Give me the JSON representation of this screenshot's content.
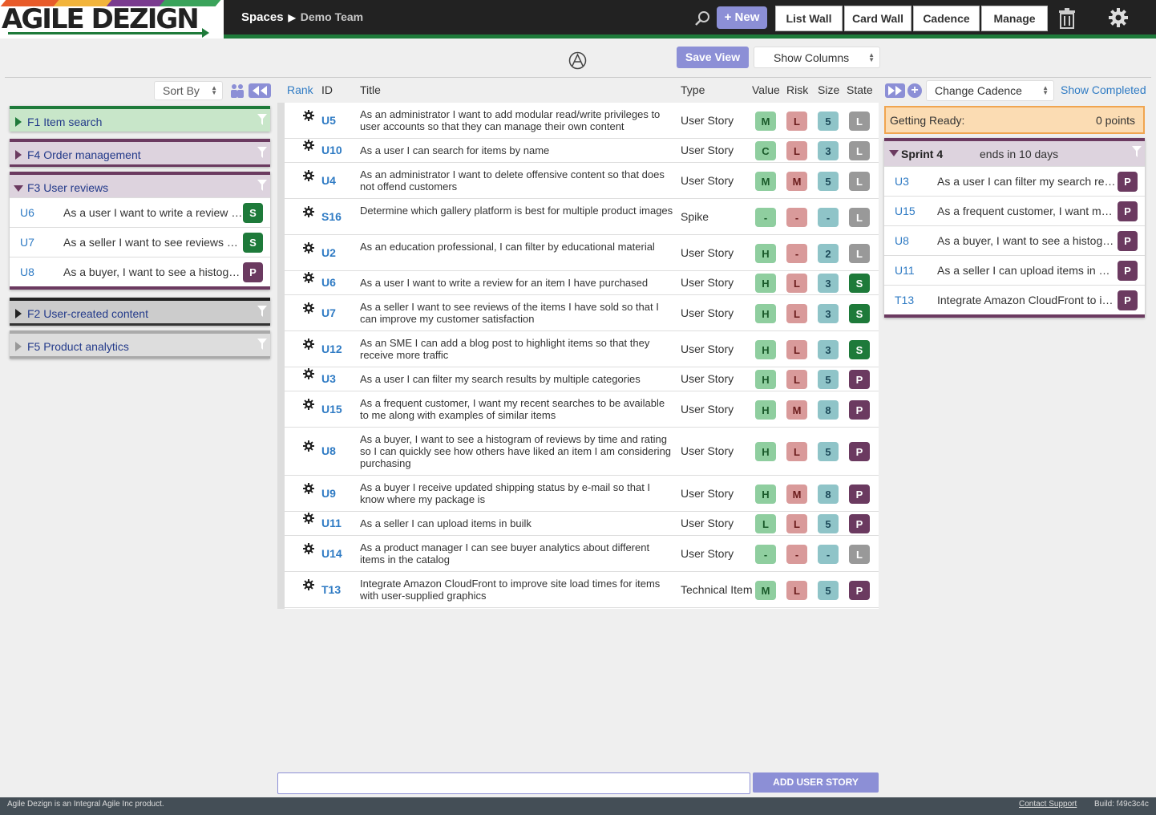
{
  "header": {
    "logo_text": "AGILE DEZIGN",
    "breadcrumb_spaces": "Spaces",
    "breadcrumb_team": "Demo Team",
    "new_label": "New",
    "nav": [
      "List Wall",
      "Card Wall",
      "Cadence",
      "Manage"
    ],
    "search_icon": "search-icon",
    "trash_icon": "trash-icon",
    "settings_icon": "gear-icon"
  },
  "toolbar": {
    "save_view_label": "Save View",
    "show_columns_label": "Show Columns"
  },
  "left_panel": {
    "sort_by_label": "Sort By",
    "features": [
      {
        "label": "F1 Item search",
        "expanded": false,
        "color": "#1e7a3a",
        "bg": "#c8e6c9",
        "items": []
      },
      {
        "label": "F4 Order management",
        "expanded": false,
        "color": "#6b3a60",
        "bg": "#ddd3de",
        "items": []
      },
      {
        "label": "F3 User reviews",
        "expanded": true,
        "color": "#6b3a60",
        "bg": "#ddd3de",
        "items": [
          {
            "id": "U6",
            "title": "As a user I want to write a review for an item I have purchased",
            "state": "S"
          },
          {
            "id": "U7",
            "title": "As a seller I want to see reviews of the items I have sold so that I can improve my customer satisfaction",
            "state": "S"
          },
          {
            "id": "U8",
            "title": "As a buyer, I want to see a histogram of reviews by time and rating",
            "state": "P"
          }
        ]
      },
      {
        "label": "F2 User-created content",
        "expanded": false,
        "color": "#222222",
        "bg": "#cccccc",
        "items": []
      },
      {
        "label": "F5 Product analytics",
        "expanded": false,
        "color": "#999999",
        "bg": "#dddddd",
        "items": []
      }
    ]
  },
  "table": {
    "headers": {
      "rank": "Rank",
      "id": "ID",
      "title": "Title",
      "type": "Type",
      "value": "Value",
      "risk": "Risk",
      "size": "Size",
      "state": "State"
    },
    "rows": [
      {
        "id": "U5",
        "title": "As an administrator I want to add modular read/write privileges to user accounts so that they can manage their own content",
        "type": "User Story",
        "value": "M",
        "risk": "L",
        "size": "5",
        "state": "L"
      },
      {
        "id": "U10",
        "title": "As a user I can search for items by name",
        "type": "User Story",
        "value": "C",
        "risk": "L",
        "size": "3",
        "state": "L"
      },
      {
        "id": "U4",
        "title": "As an administrator I want to delete offensive content so that does not offend customers",
        "type": "User Story",
        "value": "M",
        "risk": "M",
        "size": "5",
        "state": "L"
      },
      {
        "id": "S16",
        "title": "Determine which gallery platform is best for multiple product images",
        "type": "Spike",
        "value": "-",
        "risk": "-",
        "size": "-",
        "state": "L"
      },
      {
        "id": "U2",
        "title": "As an education professional, I can filter by educational material",
        "type": "User Story",
        "value": "H",
        "risk": "-",
        "size": "2",
        "state": "L"
      },
      {
        "id": "U6",
        "title": "As a user I want to write a review for an item I have purchased",
        "type": "User Story",
        "value": "H",
        "risk": "L",
        "size": "3",
        "state": "S"
      },
      {
        "id": "U7",
        "title": "As a seller I want to see reviews of the items I have sold so that I can improve my customer satisfaction",
        "type": "User Story",
        "value": "H",
        "risk": "L",
        "size": "3",
        "state": "S"
      },
      {
        "id": "U12",
        "title": "As an SME I can add a blog post to highlight items so that they receive more traffic",
        "type": "User Story",
        "value": "H",
        "risk": "L",
        "size": "3",
        "state": "S"
      },
      {
        "id": "U3",
        "title": "As a user I can filter my search results by multiple categories",
        "type": "User Story",
        "value": "H",
        "risk": "L",
        "size": "5",
        "state": "P"
      },
      {
        "id": "U15",
        "title": "As a frequent customer, I want my recent searches to be available to me along with examples of similar items",
        "type": "User Story",
        "value": "H",
        "risk": "M",
        "size": "8",
        "state": "P"
      },
      {
        "id": "U8",
        "title": "As a buyer, I want to see a histogram of reviews by time and rating so I can quickly see how others have liked an item I am considering purchasing",
        "type": "User Story",
        "value": "H",
        "risk": "L",
        "size": "5",
        "state": "P"
      },
      {
        "id": "U9",
        "title": "As a buyer I receive updated shipping status by e-mail so that I know where my package is",
        "type": "User Story",
        "value": "H",
        "risk": "M",
        "size": "8",
        "state": "P"
      },
      {
        "id": "U11",
        "title": "As a seller I can upload items in builk",
        "type": "User Story",
        "value": "L",
        "risk": "L",
        "size": "5",
        "state": "P"
      },
      {
        "id": "U14",
        "title": "As a product manager I can see buyer analytics about different items in the catalog",
        "type": "User Story",
        "value": "-",
        "risk": "-",
        "size": "-",
        "state": "L"
      },
      {
        "id": "T13",
        "title": "Integrate Amazon CloudFront to improve site load times for items with user-supplied graphics",
        "type": "Technical Item",
        "value": "M",
        "risk": "L",
        "size": "5",
        "state": "P"
      }
    ]
  },
  "add_bar": {
    "button_label": "ADD USER STORY",
    "placeholder": ""
  },
  "right_panel": {
    "change_cadence_label": "Change Cadence",
    "show_completed_label": "Show Completed",
    "getting_ready_label": "Getting Ready:",
    "getting_ready_points": "0 points",
    "sprint": {
      "name": "Sprint 4",
      "ends": "ends in 10 days",
      "items": [
        {
          "id": "U3",
          "title": "As a user I can filter my search results by multiple categories",
          "state": "P"
        },
        {
          "id": "U15",
          "title": "As a frequent customer, I want my recent searches to be available",
          "state": "P"
        },
        {
          "id": "U8",
          "title": "As a buyer, I want to see a histogram of reviews by time and rating",
          "state": "P"
        },
        {
          "id": "U11",
          "title": "As a seller I can upload items in builk",
          "state": "P"
        },
        {
          "id": "T13",
          "title": "Integrate Amazon CloudFront to improve site load times for items",
          "state": "P"
        }
      ]
    }
  },
  "footer": {
    "left": "Agile Dezign is an Integral Agile Inc product.",
    "contact": "Contact Support",
    "build": "Build: f49c3c4c"
  },
  "colors": {
    "accent": "#8c8fd6",
    "link": "#2f7bc4",
    "value_badge": "#8fce9f",
    "risk_badge": "#d99a9a",
    "size_badge": "#8fc4c8",
    "state_L": "#999999",
    "state_S": "#1e7a3a",
    "state_P": "#6b3a60"
  }
}
